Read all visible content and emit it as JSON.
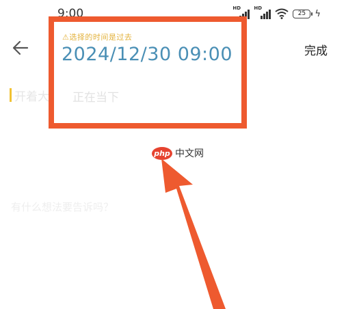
{
  "status_bar": {
    "time": "9:00",
    "signal_1": "HD",
    "signal_2": "HD",
    "battery": "25"
  },
  "header": {
    "done_label": "完成"
  },
  "highlight": {
    "warning": "⚠选择的时间是过去",
    "datetime": "2024/12/30  09:00"
  },
  "options": {
    "remind_label": "开着大",
    "focus_label": "正在当下"
  },
  "watermark": {
    "logo": "php",
    "text": "中文网"
  },
  "prompt": {
    "placeholder": "有什么想法要告诉吗？"
  },
  "colors": {
    "annotation": "#ee5a2f",
    "accent": "#f1c232",
    "datetime": "#4a8fb5",
    "warning": "#e3b23c"
  }
}
